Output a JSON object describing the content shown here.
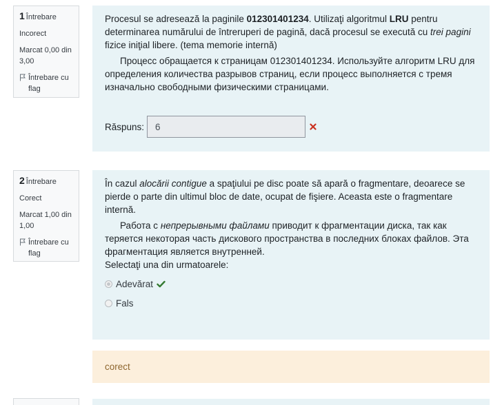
{
  "questions": [
    {
      "number": "1",
      "label": "Întrebare",
      "state": "Incorect",
      "mark": "Marcat 0,00 din 3,00",
      "flag": "Întrebare cu flag",
      "text_ro_1": "Procesul se adresează la paginile ",
      "text_ro_bold1": "012301401234",
      "text_ro_2": ". Utilizaţi algoritmul ",
      "text_ro_bold2": "LRU",
      "text_ro_3": " pentru determinarea numărului de întreruperi de pagină, dacă procesul se execută cu ",
      "text_ro_italic": "trei pagini",
      "text_ro_4": " fizice iniţial libere. (tema memorie internă)",
      "text_ru": "Процесс обращается к страницам 012301401234. Используйте алгоритм LRU для определения количества разрывов страниц, если процесс выполняется с тремя изначально свободными физическими страницами.",
      "answer_label": "Răspuns:",
      "answer_value": "6",
      "result_icon": "cross-icon",
      "result_color": "#ca3120"
    },
    {
      "number": "2",
      "label": "Întrebare",
      "state": "Corect",
      "mark": "Marcat 1,00 din 1,00",
      "flag": "Întrebare cu flag",
      "text_ro_1": "În cazul ",
      "text_ro_italic": "alocării contigue",
      "text_ro_2": " a spaţiului pe disc poate să apară o fragmentare, deoarece se pierde o parte din ultimul bloc de date, ocupat de fişiere. Aceasta este o fragmentare internă.",
      "text_ru_1": "Работа с ",
      "text_ru_italic": "непрерывными файлами",
      "text_ru_2": " приводит к фрагментации диска, так как теряется некоторая часть дискового пространства в последних блоках файлов.  Эта фрагментация является внутренней.",
      "prompt": "Selectaţi una din urmatoarele:",
      "options": [
        {
          "label": "Adevărat",
          "selected": true,
          "result_icon": "check-icon"
        },
        {
          "label": "Fals",
          "selected": false
        }
      ],
      "result_color": "#357a32",
      "feedback": "corect"
    }
  ]
}
